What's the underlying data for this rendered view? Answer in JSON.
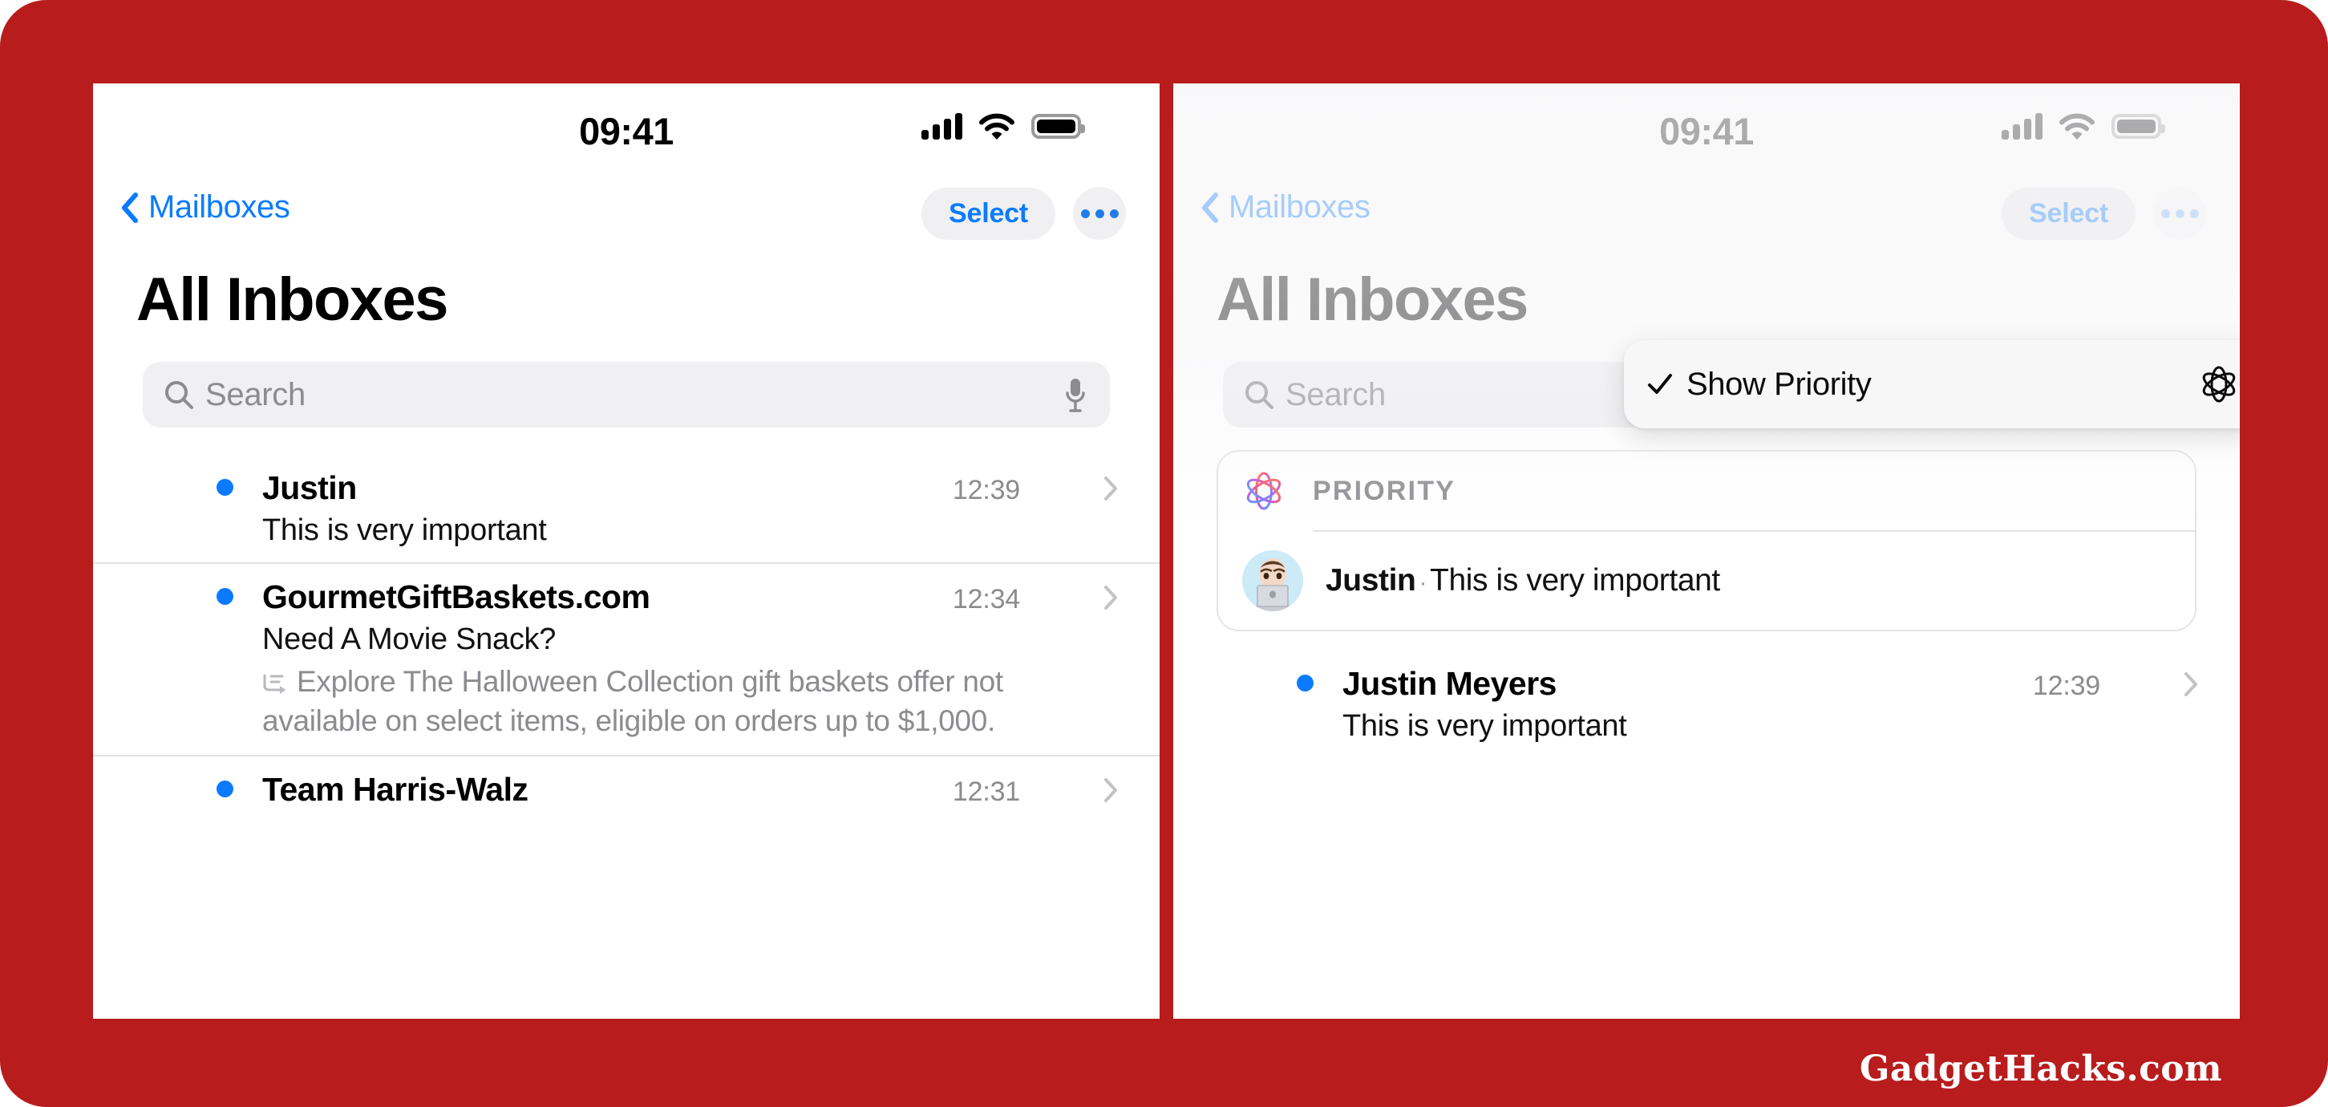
{
  "branding": {
    "watermark": "GadgetHacks.com",
    "backdrop_color": "#b81c1c"
  },
  "colors": {
    "accent_blue": "#0a7bff",
    "unread_dot": "#0a7bff",
    "muted_gray": "#8b8b90",
    "chip_gray": "#f0f0f2"
  },
  "status_bar": {
    "time": "09:41",
    "signal_icon": "cellular-signal-icon",
    "wifi_icon": "wifi-icon",
    "battery_icon": "battery-icon"
  },
  "nav": {
    "back_label": "Mailboxes",
    "back_icon": "chevron-left-icon",
    "select_label": "Select",
    "more_icon": "ellipsis-icon"
  },
  "page": {
    "title": "All Inboxes"
  },
  "search": {
    "placeholder": "Search",
    "search_icon": "magnifier-icon",
    "mic_icon": "microphone-icon"
  },
  "left_panel": {
    "messages": [
      {
        "sender": "Justin",
        "time": "12:39",
        "subject": "This is very important",
        "preview": "",
        "unread": true,
        "has_list_icon": false
      },
      {
        "sender": "GourmetGiftBaskets.com",
        "time": "12:34",
        "subject": "Need A Movie Snack?",
        "preview": "Explore The Halloween Collection gift baskets offer not available on select items, eligible on orders up to $1,000.",
        "unread": true,
        "has_list_icon": true
      },
      {
        "sender": "Team Harris-Walz",
        "time": "12:31",
        "subject": "",
        "preview": "",
        "unread": true,
        "has_list_icon": false
      }
    ]
  },
  "right_panel": {
    "popover": {
      "check_icon": "checkmark-icon",
      "label": "Show Priority",
      "ai_icon": "apple-intelligence-icon",
      "checked": true
    },
    "priority_card": {
      "ai_icon": "apple-intelligence-icon",
      "header": "PRIORITY",
      "avatar_icon": "memoji-avatar",
      "sender": "Justin",
      "separator": "·",
      "snippet": "This is very important"
    },
    "messages": [
      {
        "sender": "Justin Meyers",
        "time": "12:39",
        "subject": "This is very important",
        "preview": "",
        "unread": true,
        "has_list_icon": false
      }
    ]
  }
}
